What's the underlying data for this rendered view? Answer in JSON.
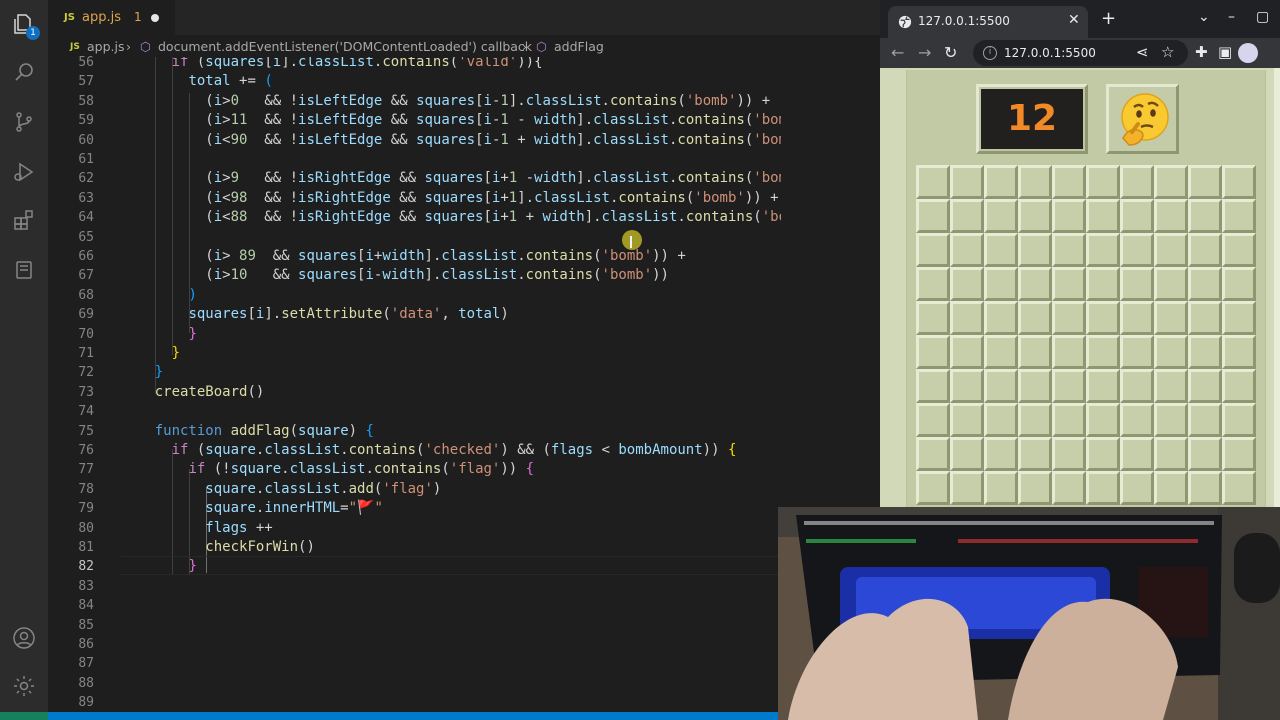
{
  "editor": {
    "activity_badge": "1",
    "tab": {
      "lang": "JS",
      "filename": "app.js",
      "problems": "1"
    },
    "breadcrumb": {
      "lang": "JS",
      "file": "app.js",
      "separator": "›",
      "symbol_1": "document.addEventListener('DOMContentLoaded') callback",
      "symbol_2": "addFlag"
    },
    "line_numbers": [
      "56",
      "57",
      "58",
      "59",
      "60",
      "61",
      "62",
      "63",
      "64",
      "65",
      "66",
      "67",
      "68",
      "69",
      "70",
      "71",
      "72",
      "73",
      "74",
      "75",
      "76",
      "77",
      "78",
      "79",
      "80",
      "81",
      "82",
      "83",
      "84",
      "85",
      "86",
      "87",
      "88",
      "89"
    ],
    "current_line": "82",
    "lines": [
      [
        {
          "t": "      "
        },
        {
          "t": "if",
          "c": "ct"
        },
        {
          "t": " ("
        },
        {
          "t": "squares",
          "c": "vr"
        },
        {
          "t": "["
        },
        {
          "t": "i",
          "c": "vr"
        },
        {
          "t": "]."
        },
        {
          "t": "classList",
          "c": "vr"
        },
        {
          "t": "."
        },
        {
          "t": "contains",
          "c": "fn"
        },
        {
          "t": "("
        },
        {
          "t": "'valid'",
          "c": "st"
        },
        {
          "t": ")){"
        }
      ],
      [
        {
          "t": "        "
        },
        {
          "t": "total",
          "c": "vr"
        },
        {
          "t": " += "
        },
        {
          "t": "(",
          "c": "b3"
        }
      ],
      [
        {
          "t": "          ("
        },
        {
          "t": "i",
          "c": "vr"
        },
        {
          "t": ">"
        },
        {
          "t": "0",
          "c": "nm"
        },
        {
          "t": "   && !"
        },
        {
          "t": "isLeftEdge",
          "c": "vr"
        },
        {
          "t": " && "
        },
        {
          "t": "squares",
          "c": "vr"
        },
        {
          "t": "["
        },
        {
          "t": "i",
          "c": "vr"
        },
        {
          "t": "-"
        },
        {
          "t": "1",
          "c": "nm"
        },
        {
          "t": "]."
        },
        {
          "t": "classList",
          "c": "vr"
        },
        {
          "t": "."
        },
        {
          "t": "contains",
          "c": "fn"
        },
        {
          "t": "("
        },
        {
          "t": "'bomb'",
          "c": "st"
        },
        {
          "t": ")) +"
        }
      ],
      [
        {
          "t": "          ("
        },
        {
          "t": "i",
          "c": "vr"
        },
        {
          "t": ">"
        },
        {
          "t": "11",
          "c": "nm"
        },
        {
          "t": "  && !"
        },
        {
          "t": "isLeftEdge",
          "c": "vr"
        },
        {
          "t": " && "
        },
        {
          "t": "squares",
          "c": "vr"
        },
        {
          "t": "["
        },
        {
          "t": "i",
          "c": "vr"
        },
        {
          "t": "-"
        },
        {
          "t": "1",
          "c": "nm"
        },
        {
          "t": " - "
        },
        {
          "t": "width",
          "c": "vr"
        },
        {
          "t": "]."
        },
        {
          "t": "classList",
          "c": "vr"
        },
        {
          "t": "."
        },
        {
          "t": "contains",
          "c": "fn"
        },
        {
          "t": "("
        },
        {
          "t": "'bomb'",
          "c": "st"
        },
        {
          "t": ")) +"
        }
      ],
      [
        {
          "t": "          ("
        },
        {
          "t": "i",
          "c": "vr"
        },
        {
          "t": "<"
        },
        {
          "t": "90",
          "c": "nm"
        },
        {
          "t": "  && !"
        },
        {
          "t": "isLeftEdge",
          "c": "vr"
        },
        {
          "t": " && "
        },
        {
          "t": "squares",
          "c": "vr"
        },
        {
          "t": "["
        },
        {
          "t": "i",
          "c": "vr"
        },
        {
          "t": "-"
        },
        {
          "t": "1",
          "c": "nm"
        },
        {
          "t": " + "
        },
        {
          "t": "width",
          "c": "vr"
        },
        {
          "t": "]."
        },
        {
          "t": "classList",
          "c": "vr"
        },
        {
          "t": "."
        },
        {
          "t": "contains",
          "c": "fn"
        },
        {
          "t": "("
        },
        {
          "t": "'bomb'",
          "c": "st"
        },
        {
          "t": ")) +"
        }
      ],
      [
        {
          "t": ""
        }
      ],
      [
        {
          "t": "          ("
        },
        {
          "t": "i",
          "c": "vr"
        },
        {
          "t": ">"
        },
        {
          "t": "9",
          "c": "nm"
        },
        {
          "t": "   && !"
        },
        {
          "t": "isRightEdge",
          "c": "vr"
        },
        {
          "t": " && "
        },
        {
          "t": "squares",
          "c": "vr"
        },
        {
          "t": "["
        },
        {
          "t": "i",
          "c": "vr"
        },
        {
          "t": "+"
        },
        {
          "t": "1",
          "c": "nm"
        },
        {
          "t": " -"
        },
        {
          "t": "width",
          "c": "vr"
        },
        {
          "t": "]."
        },
        {
          "t": "classList",
          "c": "vr"
        },
        {
          "t": "."
        },
        {
          "t": "contains",
          "c": "fn"
        },
        {
          "t": "("
        },
        {
          "t": "'bomb'",
          "c": "st"
        },
        {
          "t": ")) +"
        }
      ],
      [
        {
          "t": "          ("
        },
        {
          "t": "i",
          "c": "vr"
        },
        {
          "t": "<"
        },
        {
          "t": "98",
          "c": "nm"
        },
        {
          "t": "  && !"
        },
        {
          "t": "isRightEdge",
          "c": "vr"
        },
        {
          "t": " && "
        },
        {
          "t": "squares",
          "c": "vr"
        },
        {
          "t": "["
        },
        {
          "t": "i",
          "c": "vr"
        },
        {
          "t": "+"
        },
        {
          "t": "1",
          "c": "nm"
        },
        {
          "t": "]."
        },
        {
          "t": "classList",
          "c": "vr"
        },
        {
          "t": "."
        },
        {
          "t": "contains",
          "c": "fn"
        },
        {
          "t": "("
        },
        {
          "t": "'bomb'",
          "c": "st"
        },
        {
          "t": ")) +"
        }
      ],
      [
        {
          "t": "          ("
        },
        {
          "t": "i",
          "c": "vr"
        },
        {
          "t": "<"
        },
        {
          "t": "88",
          "c": "nm"
        },
        {
          "t": "  && !"
        },
        {
          "t": "isRightEdge",
          "c": "vr"
        },
        {
          "t": " && "
        },
        {
          "t": "squares",
          "c": "vr"
        },
        {
          "t": "["
        },
        {
          "t": "i",
          "c": "vr"
        },
        {
          "t": "+"
        },
        {
          "t": "1",
          "c": "nm"
        },
        {
          "t": " + "
        },
        {
          "t": "width",
          "c": "vr"
        },
        {
          "t": "]."
        },
        {
          "t": "classList",
          "c": "vr"
        },
        {
          "t": "."
        },
        {
          "t": "contains",
          "c": "fn"
        },
        {
          "t": "("
        },
        {
          "t": "'bomb'",
          "c": "st"
        },
        {
          "t": ")) +"
        }
      ],
      [
        {
          "t": ""
        }
      ],
      [
        {
          "t": "          ("
        },
        {
          "t": "i",
          "c": "vr"
        },
        {
          "t": "> "
        },
        {
          "t": "89",
          "c": "nm"
        },
        {
          "t": "  && "
        },
        {
          "t": "squares",
          "c": "vr"
        },
        {
          "t": "["
        },
        {
          "t": "i",
          "c": "vr"
        },
        {
          "t": "+"
        },
        {
          "t": "width",
          "c": "vr"
        },
        {
          "t": "]."
        },
        {
          "t": "classList",
          "c": "vr"
        },
        {
          "t": "."
        },
        {
          "t": "contains",
          "c": "fn"
        },
        {
          "t": "("
        },
        {
          "t": "'bomb'",
          "c": "st"
        },
        {
          "t": ")) +"
        }
      ],
      [
        {
          "t": "          ("
        },
        {
          "t": "i",
          "c": "vr"
        },
        {
          "t": ">"
        },
        {
          "t": "10",
          "c": "nm"
        },
        {
          "t": "   && "
        },
        {
          "t": "squares",
          "c": "vr"
        },
        {
          "t": "["
        },
        {
          "t": "i",
          "c": "vr"
        },
        {
          "t": "-"
        },
        {
          "t": "width",
          "c": "vr"
        },
        {
          "t": "]."
        },
        {
          "t": "classList",
          "c": "vr"
        },
        {
          "t": "."
        },
        {
          "t": "contains",
          "c": "fn"
        },
        {
          "t": "("
        },
        {
          "t": "'bomb'",
          "c": "st"
        },
        {
          "t": "))"
        }
      ],
      [
        {
          "t": "        "
        },
        {
          "t": ")",
          "c": "b3"
        }
      ],
      [
        {
          "t": "        "
        },
        {
          "t": "squares",
          "c": "vr"
        },
        {
          "t": "["
        },
        {
          "t": "i",
          "c": "vr"
        },
        {
          "t": "]."
        },
        {
          "t": "setAttribute",
          "c": "fn"
        },
        {
          "t": "("
        },
        {
          "t": "'data'",
          "c": "st"
        },
        {
          "t": ", "
        },
        {
          "t": "total",
          "c": "vr"
        },
        {
          "t": ")"
        }
      ],
      [
        {
          "t": "        "
        },
        {
          "t": "}",
          "c": "b2"
        }
      ],
      [
        {
          "t": "      "
        },
        {
          "t": "}",
          "c": "b1"
        }
      ],
      [
        {
          "t": "    "
        },
        {
          "t": "}",
          "c": "b3"
        }
      ],
      [
        {
          "t": "    "
        },
        {
          "t": "createBoard",
          "c": "fn"
        },
        {
          "t": "()"
        }
      ],
      [
        {
          "t": ""
        }
      ],
      [
        {
          "t": "    "
        },
        {
          "t": "function",
          "c": "kw"
        },
        {
          "t": " "
        },
        {
          "t": "addFlag",
          "c": "fn"
        },
        {
          "t": "("
        },
        {
          "t": "square",
          "c": "vr"
        },
        {
          "t": ") "
        },
        {
          "t": "{",
          "c": "b3"
        }
      ],
      [
        {
          "t": "      "
        },
        {
          "t": "if",
          "c": "ct"
        },
        {
          "t": " ("
        },
        {
          "t": "square",
          "c": "vr"
        },
        {
          "t": "."
        },
        {
          "t": "classList",
          "c": "vr"
        },
        {
          "t": "."
        },
        {
          "t": "contains",
          "c": "fn"
        },
        {
          "t": "("
        },
        {
          "t": "'checked'",
          "c": "st"
        },
        {
          "t": ") && ("
        },
        {
          "t": "flags",
          "c": "vr"
        },
        {
          "t": " < "
        },
        {
          "t": "bombAmount",
          "c": "vr"
        },
        {
          "t": ")) "
        },
        {
          "t": "{",
          "c": "b1"
        }
      ],
      [
        {
          "t": "        "
        },
        {
          "t": "if",
          "c": "ct"
        },
        {
          "t": " (!"
        },
        {
          "t": "square",
          "c": "vr"
        },
        {
          "t": "."
        },
        {
          "t": "classList",
          "c": "vr"
        },
        {
          "t": "."
        },
        {
          "t": "contains",
          "c": "fn"
        },
        {
          "t": "("
        },
        {
          "t": "'flag'",
          "c": "st"
        },
        {
          "t": ")) "
        },
        {
          "t": "{",
          "c": "b2"
        }
      ],
      [
        {
          "t": "          "
        },
        {
          "t": "square",
          "c": "vr"
        },
        {
          "t": "."
        },
        {
          "t": "classList",
          "c": "vr"
        },
        {
          "t": "."
        },
        {
          "t": "add",
          "c": "fn"
        },
        {
          "t": "("
        },
        {
          "t": "'flag'",
          "c": "st"
        },
        {
          "t": ")"
        }
      ],
      [
        {
          "t": "          "
        },
        {
          "t": "square",
          "c": "vr"
        },
        {
          "t": "."
        },
        {
          "t": "innerHTML",
          "c": "vr"
        },
        {
          "t": "="
        },
        {
          "t": "\"🚩\"",
          "c": "st"
        }
      ],
      [
        {
          "t": "          "
        },
        {
          "t": "flags",
          "c": "vr"
        },
        {
          "t": " ++"
        }
      ],
      [
        {
          "t": "          "
        },
        {
          "t": "checkForWin",
          "c": "fn"
        },
        {
          "t": "()"
        }
      ],
      [
        {
          "t": "        "
        },
        {
          "t": "}",
          "c": "b2"
        }
      ],
      [
        {
          "t": ""
        }
      ],
      [
        {
          "t": ""
        }
      ],
      [
        {
          "t": ""
        }
      ],
      [
        {
          "t": ""
        }
      ],
      [
        {
          "t": ""
        }
      ],
      [
        {
          "t": ""
        }
      ],
      [
        {
          "t": ""
        }
      ]
    ]
  },
  "browser": {
    "tab_title": "127.0.0.1:5500",
    "close_glyph": "✕",
    "new_tab_glyph": "+",
    "address": "127.0.0.1:5500",
    "minimize_glyph": "–",
    "maximize_glyph": "▢",
    "dropdown_glyph": "⌄"
  },
  "game": {
    "flags_left": "12",
    "face_icon": "thinking-face-icon",
    "rows": 10,
    "cols": 10
  },
  "colors": {
    "accent": "#007acc",
    "counter_digits": "#f28b27",
    "board": "#c7cfaa"
  }
}
